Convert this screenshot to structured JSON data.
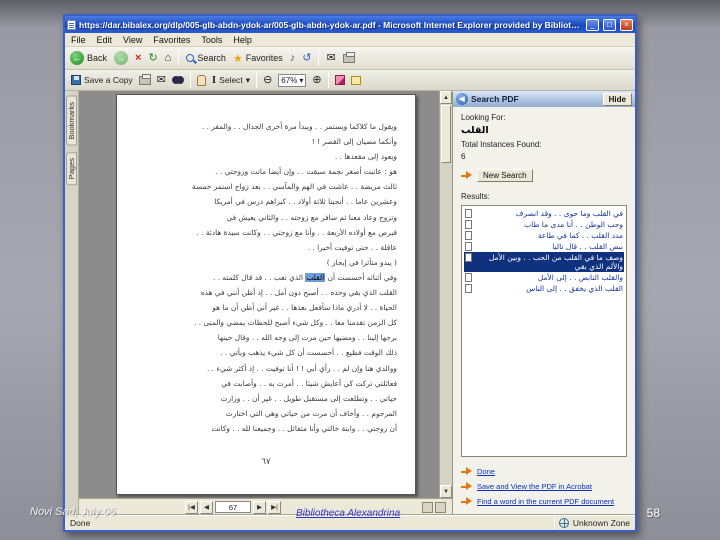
{
  "slide": {
    "footer_left": "Novi Sad, July 06",
    "footer_center": "Bibliotheca Alexandrina",
    "footer_right": "58"
  },
  "window": {
    "title": "https://dar.bibalex.org/dlp/005-glb-abdn-ydok-ar/005-glb-abdn-ydok-ar.pdf - Microsoft Internet Explorer provided by Bibliotheca",
    "controls": {
      "minimize": "_",
      "maximize": "□",
      "close": "×"
    }
  },
  "menu_bar": {
    "items": [
      "File",
      "Edit",
      "View",
      "Favorites",
      "Tools",
      "Help"
    ]
  },
  "browser_toolbar": {
    "back_label": "Back",
    "search_label": "Search",
    "favorites_label": "Favorites"
  },
  "pdf_toolbar": {
    "save_label": "Save a Copy",
    "select_label": "Select",
    "zoom_value": "67%"
  },
  "nav_tabs": {
    "bookmarks": "Bookmarks",
    "pages": "Pages"
  },
  "page": {
    "page_number": "٦٧",
    "highlight_line": 10,
    "highlight_term": "القلب",
    "lines": [
      "ويقول ما كلاكما ويستمر . . ويبدأ مرة أخرى الجدال . . والمفر . .",
      "وأنكما مضيان إلى القصر ! !",
      "ويعود إلى مقعدها . .",
      "هو : عاتبت أصغر نجمة سبقت . . وإن أيضا ماتت وزوجتي . .",
      "ثالث مريضة . . عاشت في الهم والمآسي . . بعد زواج استمر خمسة",
      "وعشرين عاما . . أنجبنا ثلاثة أولاد . . كبراهم درس في أمريكا",
      "وتزوج وعاد معنا ثم سافر مع زوجته . . والثاني يعيش في",
      "قبرص مع أولاده الأربعة . . وأنا مع زوجتي . . وكانت سيدة هادئة . .",
      "عاقلة . . حتى توفيت أخيرا . .",
      "( يبدو متأثرا في إيجاز )",
      "وفي أثنائه أحسست أن القلب الذي تعب . . قد قال كلمته . .",
      "القلب الذي بقي وحده . . أصبح دون أمل . . إذ أظن أنني في هذه",
      "الحياة . . لا أدري ماذا سأفعل بعدها . . غير أني أظن أن ما هو",
      "كل الزمن تقدمنا معا . . وكل شيء أصبح للحظات يمضي والمنى . .",
      "برجها إلينا . . ومضيها حين مرت إلى وجه الله . . وقال حينها",
      "ذلك الوقت فظيع . . أحسست أن كل شيء يذهب ويأتي . .",
      "ووالدي هنا وإن لم . . رأي أبي ! ! أنا توفيت . . إذ أكثر شيء . .",
      "فعائلتي تركت كي أعايش شيئا . . أمرت به . . وأصابت في",
      "حياتي . . وتطلعت إلى مستقبل طويل . . غير أن . . وزارت",
      "المرحوم . . وأخاف أن مرت من حياتي وهي التي اختارت",
      "أن زوجتي . . وابنة خالتي وأنا متفائل . . وجميعنا لله . . وكانت"
    ]
  },
  "search_pane": {
    "title": "Search PDF",
    "hide_label": "Hide",
    "looking_for_label": "Looking For:",
    "term": "القلب",
    "total_label": "Total Instances Found:",
    "total_value": "6",
    "new_search_label": "New Search",
    "results_label": "Results:",
    "results": [
      {
        "text": "في القلب وما حوى . . وقد انصرف",
        "selected": false
      },
      {
        "text": "وحب الوطن . . أنا مدى ما طاب",
        "selected": false
      },
      {
        "text": "مدد القلب . . كما في طاعة",
        "selected": false
      },
      {
        "text": "نبض القلب . . قال تاليا",
        "selected": false
      },
      {
        "text": "وصف ما في القلب من الحب . . وبين الأمل والألم الذي بقي",
        "selected": true
      },
      {
        "text": "والقلب النابض . . إلى الأمل",
        "selected": false
      },
      {
        "text": "القلب الذي يخفق . . إلى الناس",
        "selected": false
      }
    ],
    "links": [
      "Done",
      "Save and View the PDF in Acrobat",
      "Find a word in the current PDF document"
    ]
  },
  "pdf_status": {
    "page_display": "67"
  },
  "status_bar": {
    "left": "Done",
    "zone": "Unknown Zone"
  }
}
